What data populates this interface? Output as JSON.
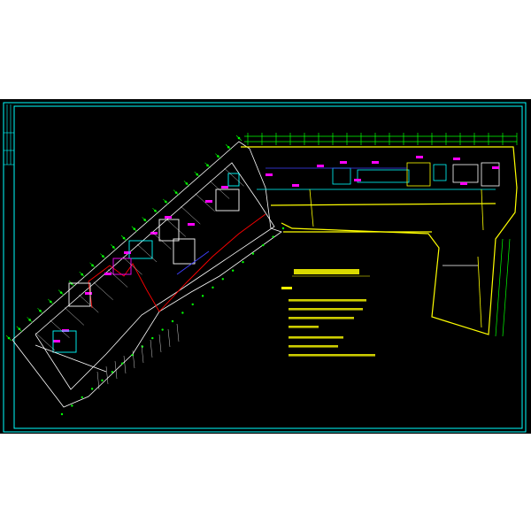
{
  "drawing": {
    "title_text": "",
    "notes_heading": "",
    "note_lines": [
      "",
      "",
      "",
      "",
      "",
      ""
    ],
    "palette": {
      "frame": "#00ffff",
      "wall_yellow": "#ffff00",
      "grid_green": "#00ff00",
      "accent_magenta": "#ff00ff",
      "pipe_red": "#ff0000",
      "blue": "#4040ff",
      "white": "#ffffff",
      "background": "#000000"
    }
  }
}
